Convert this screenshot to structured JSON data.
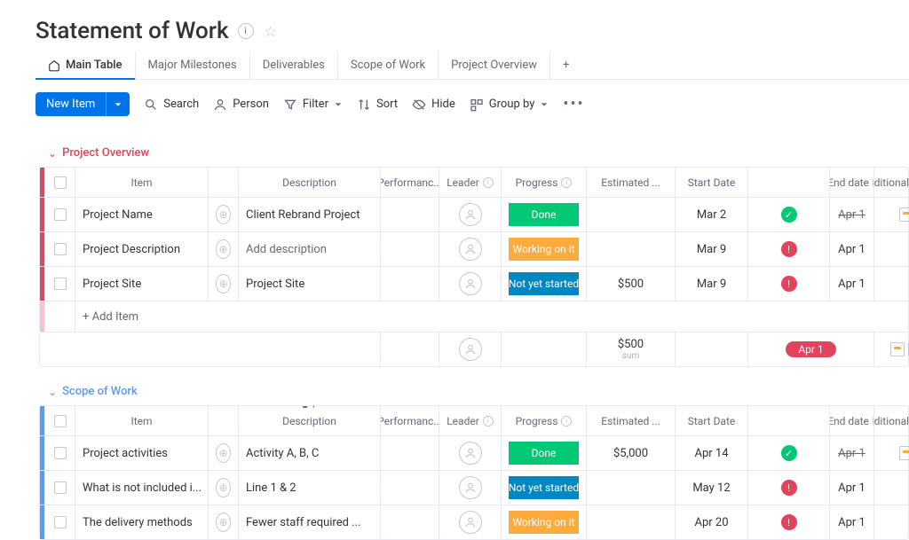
{
  "header": {
    "title": "Statement of Work"
  },
  "tabs": [
    {
      "label": "Main Table",
      "active": true
    },
    {
      "label": "Major Milestones"
    },
    {
      "label": "Deliverables"
    },
    {
      "label": "Scope of Work"
    },
    {
      "label": "Project Overview"
    }
  ],
  "toolbar": {
    "new_item": "New Item",
    "search": "Search",
    "person": "Person",
    "filter": "Filter",
    "sort": "Sort",
    "hide": "Hide",
    "group_by": "Group by"
  },
  "columns": {
    "item": "Item",
    "description": "Description",
    "performance": "Performanc...",
    "leader": "Leader",
    "progress": "Progress",
    "estimated": "Estimated ...",
    "start_date": "Start Date",
    "end_date": "End date",
    "additional": "Additional Inform..."
  },
  "groups": [
    {
      "name": "Project Overview",
      "color": "red",
      "rows": [
        {
          "item": "Project Name",
          "description": "Client Rebrand Project",
          "progress": "Done",
          "progress_type": "done",
          "estimated": "",
          "start_date": "Mar 2",
          "end_status": "green",
          "end_date": "Apr 1",
          "end_strike": true,
          "file": true
        },
        {
          "item": "Project Description",
          "description": "Add description",
          "progress": "Working on it",
          "progress_type": "working",
          "estimated": "",
          "start_date": "Mar 9",
          "end_status": "red",
          "end_date": "Apr 1",
          "end_strike": false,
          "file": false
        },
        {
          "item": "Project Site",
          "description": "Project Site",
          "progress": "Not yet started",
          "progress_type": "notyet",
          "estimated": "$500",
          "start_date": "Mar 9",
          "end_status": "red",
          "end_date": "Apr 1",
          "end_strike": false,
          "file": false
        }
      ],
      "add_item": "+ Add Item",
      "summary": {
        "estimated": "$500",
        "estimated_label": "sum",
        "end_date": "Apr 1"
      }
    },
    {
      "name": "Scope of Work",
      "color": "blue",
      "rows": [
        {
          "item": "Project activities",
          "description": "Activity A, B, C",
          "progress": "Done",
          "progress_type": "done",
          "estimated": "$5,000",
          "start_date": "Apr 14",
          "end_status": "green",
          "end_date": "Apr 1",
          "end_strike": true,
          "file": true
        },
        {
          "item": "What is not included i...",
          "description": "Line 1 & 2",
          "progress": "Not yet started",
          "progress_type": "notyet",
          "estimated": "",
          "start_date": "May 12",
          "end_status": "red",
          "end_date": "Apr 1",
          "end_strike": false,
          "file": false
        },
        {
          "item": "The delivery methods",
          "description": "Fewer staff required ...",
          "progress": "Working on it",
          "progress_type": "working",
          "estimated": "",
          "start_date": "Apr 20",
          "end_status": "red",
          "end_date": "Apr 1",
          "end_strike": false,
          "file": false
        }
      ]
    }
  ]
}
